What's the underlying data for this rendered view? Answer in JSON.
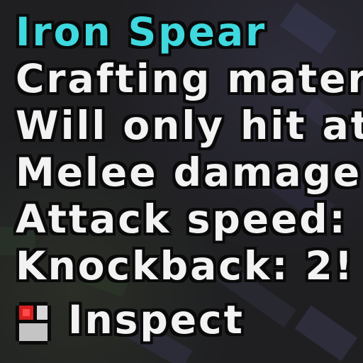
{
  "tooltip": {
    "title": "Iron Spear",
    "title_color": "#3ed8de",
    "lines": [
      "Crafting mater",
      "Will only hit at",
      "Melee damage",
      "Attack speed:",
      "Knockback: 2!"
    ],
    "text_color": "#f2f2f2",
    "action": {
      "icon": "mouse-left-click-icon",
      "label": "Inspect"
    }
  }
}
